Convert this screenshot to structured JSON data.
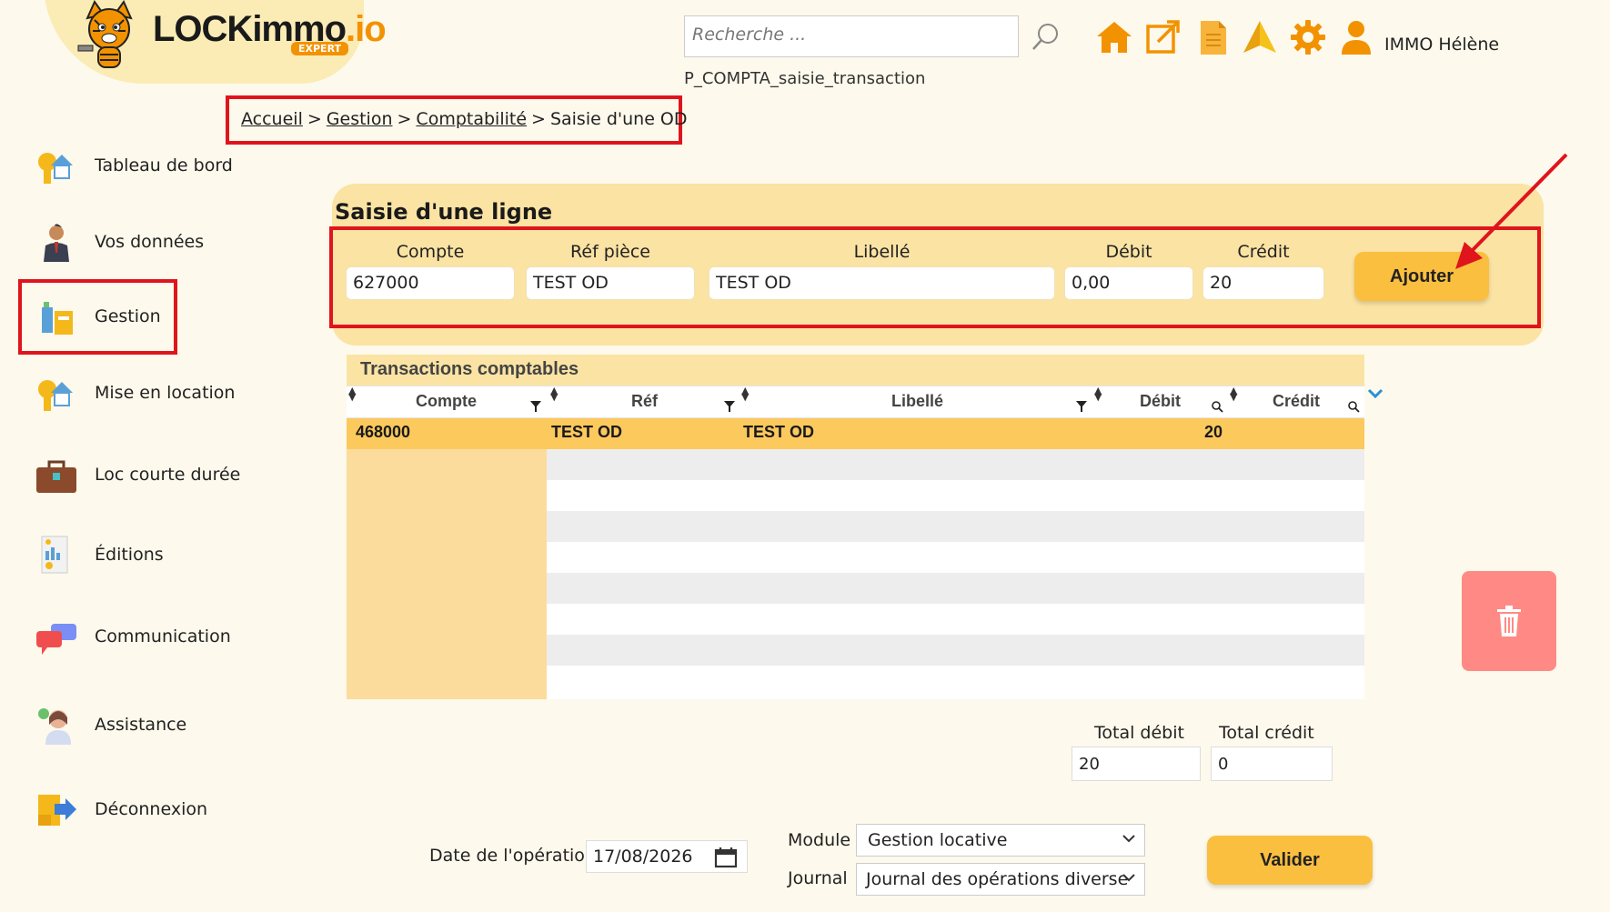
{
  "header": {
    "logo_text": "LOCKimmo",
    "logo_suffix": ".io",
    "logo_badge": "EXPERT",
    "search_placeholder": "Recherche ...",
    "page_code": "P_COMPTA_saisie_transaction",
    "user_name": "IMMO Hélène",
    "icons": [
      "search-icon",
      "home-icon",
      "external-link-icon",
      "document-icon",
      "alert-icon",
      "gear-icon",
      "user-icon"
    ]
  },
  "breadcrumb": {
    "items": [
      "Accueil",
      "Gestion",
      "Comptabilité"
    ],
    "current": "Saisie d'une OD",
    "separator": ">"
  },
  "sidebar": {
    "items": [
      {
        "label": "Tableau de bord",
        "icon": "dashboard-icon"
      },
      {
        "label": "Vos données",
        "icon": "person-icon"
      },
      {
        "label": "Gestion",
        "icon": "management-icon",
        "active": true
      },
      {
        "label": "Mise en location",
        "icon": "rental-icon"
      },
      {
        "label": "Loc courte durée",
        "icon": "suitcase-icon"
      },
      {
        "label": "Éditions",
        "icon": "report-icon"
      },
      {
        "label": "Communication",
        "icon": "chat-icon"
      },
      {
        "label": "Assistance",
        "icon": "support-icon"
      },
      {
        "label": "Déconnexion",
        "icon": "logout-icon"
      }
    ]
  },
  "entry": {
    "title": "Saisie d'une ligne",
    "fields": [
      {
        "label": "Compte",
        "value": "627000"
      },
      {
        "label": "Réf pièce",
        "value": "TEST OD"
      },
      {
        "label": "Libellé",
        "value": "TEST OD"
      },
      {
        "label": "Débit",
        "value": "0,00"
      },
      {
        "label": "Crédit",
        "value": "20"
      }
    ],
    "add_button": "Ajouter"
  },
  "grid": {
    "title": "Transactions comptables",
    "columns": [
      "Compte",
      "Réf",
      "Libellé",
      "Débit",
      "Crédit"
    ],
    "rows": [
      {
        "compte": "468000",
        "ref": "TEST OD",
        "libelle": "TEST OD",
        "debit": "20",
        "credit": ""
      }
    ]
  },
  "totals": {
    "debit_label": "Total débit",
    "debit_value": "20",
    "credit_label": "Total crédit",
    "credit_value": "0"
  },
  "footer": {
    "date_label": "Date de l'opération",
    "date_value": "17/08/2026",
    "module_label": "Module",
    "module_value": "Gestion locative",
    "journal_label": "Journal",
    "journal_value": "Journal des opérations diverse",
    "validate_button": "Valider"
  },
  "colors": {
    "accent": "#fbbf3f",
    "panel": "#fbe3a3",
    "highlight_border": "#e0141c",
    "delete_button": "#ff8a85"
  }
}
